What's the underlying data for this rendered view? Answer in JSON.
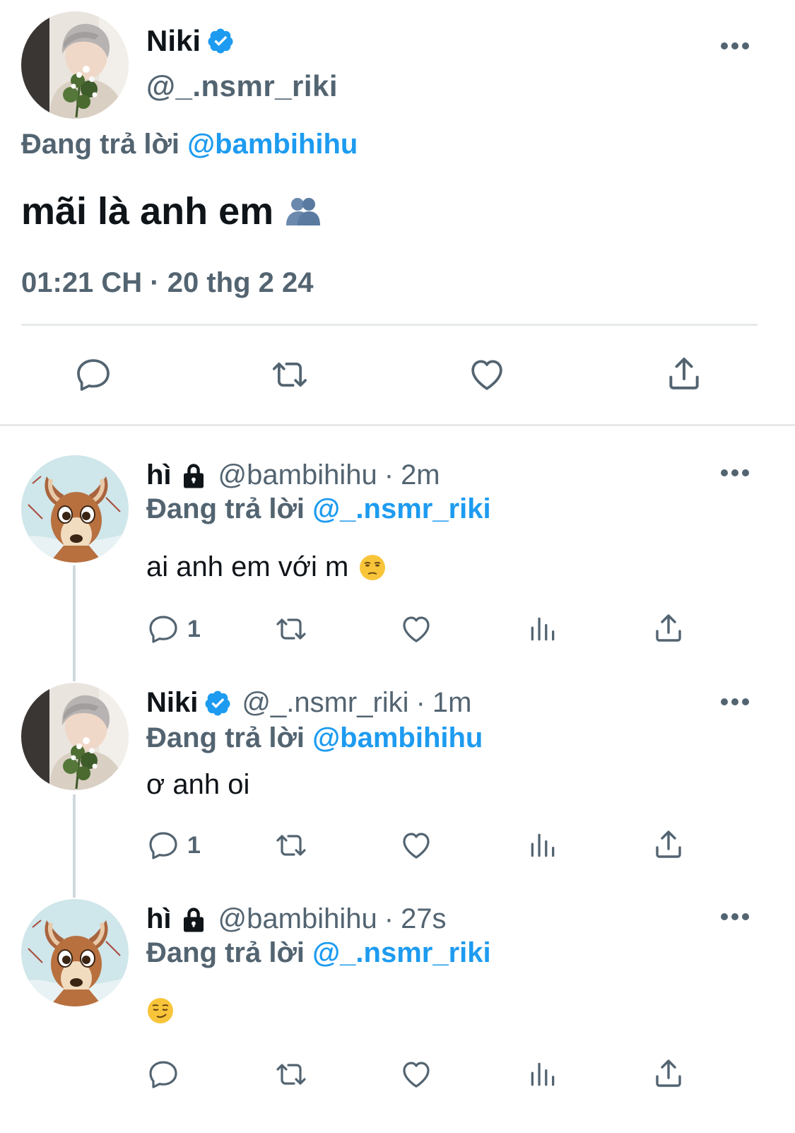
{
  "colors": {
    "accent": "#1d9bf0",
    "secondary": "#536471",
    "text": "#0f1419",
    "divider": "#e7e9ea"
  },
  "main_tweet": {
    "name": "Niki",
    "verified": true,
    "handle": "@_.nsmr_riki",
    "replying_prefix": "Đang trả lời",
    "replying_to": "@bambihihu",
    "text": "mãi là anh em",
    "text_emoji": "two-people-emoji",
    "timestamp": "01:21 CH · 20 thg 2 24",
    "actions": [
      "reply-icon",
      "retweet-icon",
      "like-icon",
      "share-icon"
    ]
  },
  "replies": [
    {
      "name": "hì",
      "locked": true,
      "handle": "@bambihihu",
      "time": "2m",
      "replying_prefix": "Đang trả lời",
      "replying_to": "@_.nsmr_riki",
      "text": "ai anh em với m",
      "text_emoji": "unamused-face-emoji",
      "reply_count": "1"
    },
    {
      "name": "Niki",
      "verified": true,
      "handle": "@_.nsmr_riki",
      "time": "1m",
      "replying_prefix": "Đang trả lời",
      "replying_to": "@bambihihu",
      "text": "ơ anh oi",
      "reply_count": "1"
    },
    {
      "name": "hì",
      "locked": true,
      "handle": "@bambihihu",
      "time": "27s",
      "replying_prefix": "Đang trả lời",
      "replying_to": "@_.nsmr_riki",
      "text": "",
      "text_emoji": "smirking-face-emoji",
      "reply_count": ""
    }
  ],
  "dot_separator": "·"
}
